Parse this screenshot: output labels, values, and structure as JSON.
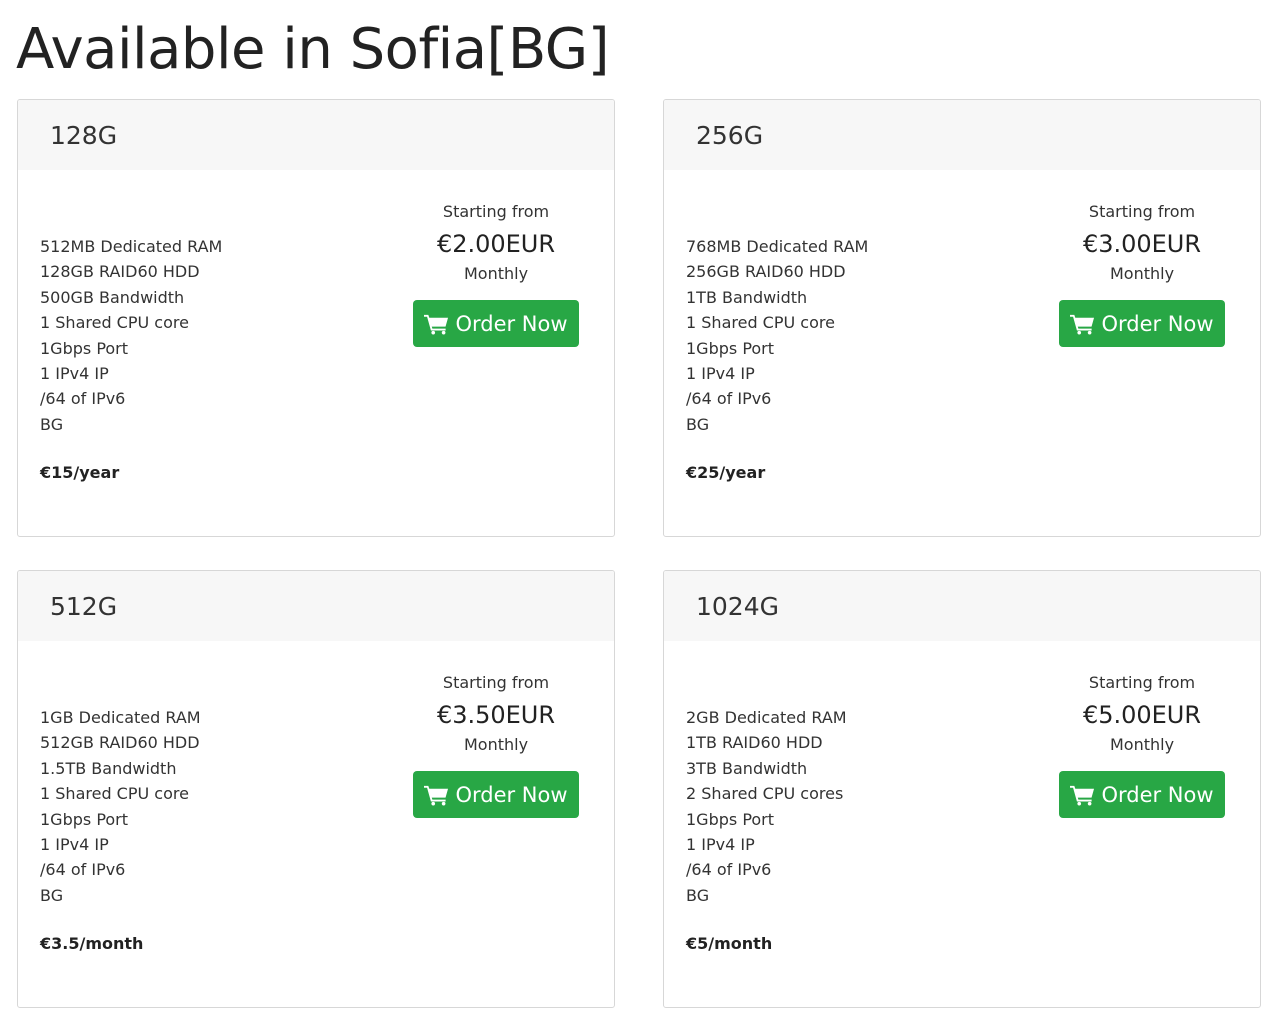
{
  "page": {
    "title": "Available in Sofia[BG]"
  },
  "colors": {
    "order_button": "#28a745",
    "card_header_bg": "#f7f7f7"
  },
  "plans": [
    {
      "name": "128G",
      "features": [
        "512MB Dedicated RAM",
        "128GB RAID60 HDD",
        "500GB Bandwidth",
        "1 Shared CPU core",
        "1Gbps Port",
        "1 IPv4 IP",
        "/64 of IPv6",
        "BG"
      ],
      "note": "€15/year",
      "starting_from": "Starting from",
      "price": "€2.00EUR",
      "cycle": "Monthly",
      "order_label": "Order Now",
      "order_icon": "shopping-cart-icon"
    },
    {
      "name": "256G",
      "features": [
        "768MB Dedicated RAM",
        "256GB RAID60 HDD",
        "1TB Bandwidth",
        "1 Shared CPU core",
        "1Gbps Port",
        "1 IPv4 IP",
        "/64 of IPv6",
        "BG"
      ],
      "note": "€25/year",
      "starting_from": "Starting from",
      "price": "€3.00EUR",
      "cycle": "Monthly",
      "order_label": "Order Now",
      "order_icon": "shopping-cart-icon"
    },
    {
      "name": "512G",
      "features": [
        "1GB Dedicated RAM",
        "512GB RAID60 HDD",
        "1.5TB Bandwidth",
        "1 Shared CPU core",
        "1Gbps Port",
        "1 IPv4 IP",
        "/64 of IPv6",
        "BG"
      ],
      "note": "€3.5/month",
      "starting_from": "Starting from",
      "price": "€3.50EUR",
      "cycle": "Monthly",
      "order_label": "Order Now",
      "order_icon": "shopping-cart-icon"
    },
    {
      "name": "1024G",
      "features": [
        "2GB Dedicated RAM",
        "1TB RAID60 HDD",
        "3TB Bandwidth",
        "2 Shared CPU cores",
        "1Gbps Port",
        "1 IPv4 IP",
        "/64 of IPv6",
        "BG"
      ],
      "note": "€5/month",
      "starting_from": "Starting from",
      "price": "€5.00EUR",
      "cycle": "Monthly",
      "order_label": "Order Now",
      "order_icon": "shopping-cart-icon"
    }
  ]
}
